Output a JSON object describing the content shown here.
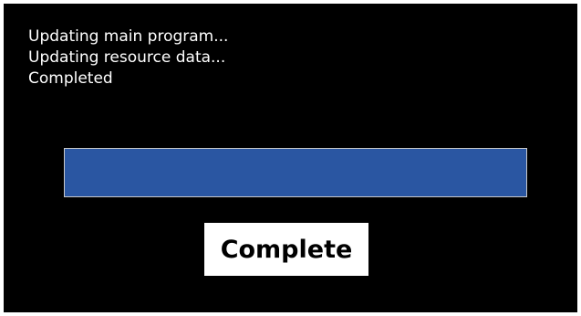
{
  "log": {
    "lines": [
      "Updating main program...",
      "Updating resource data...",
      "Completed"
    ]
  },
  "progress": {
    "fraction": 1.0,
    "fill_color": "#2a56a2",
    "border_color": "#c9c9c9"
  },
  "actions": {
    "complete_label": "Complete"
  },
  "colors": {
    "screen_background": "#000000",
    "text": "#ffffff",
    "button_background": "#ffffff",
    "button_text": "#000000"
  }
}
